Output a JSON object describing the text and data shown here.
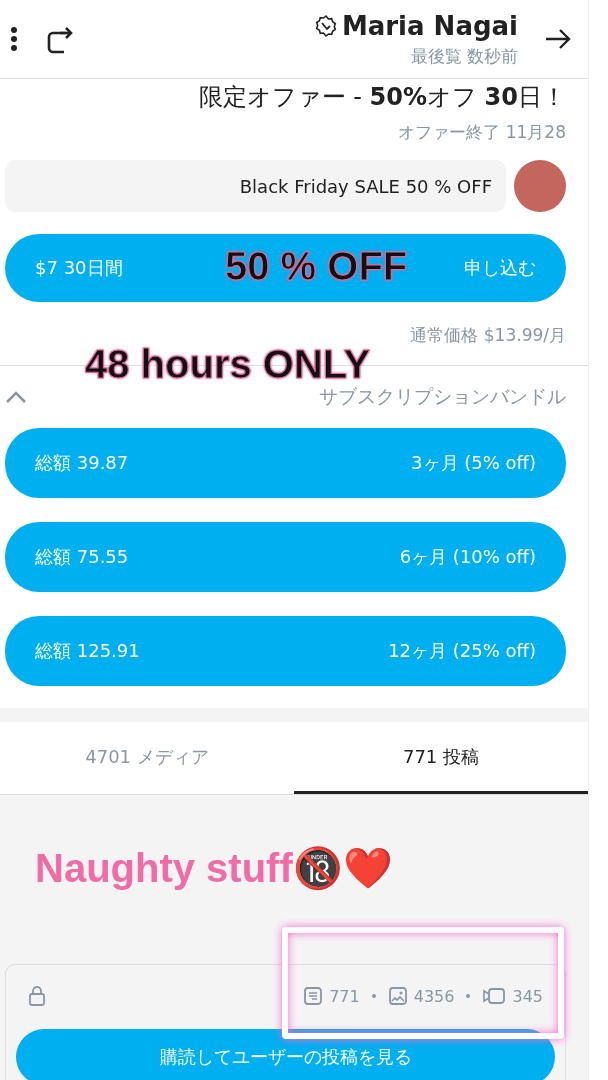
{
  "header": {
    "name": "Maria Nagai",
    "verified": true,
    "last_seen": "最後覧 数秒前"
  },
  "promo": {
    "title": "限定オファー - **50%**オフ **30**日！",
    "ends": "オファー終了 11月28",
    "message": "Black Friday SALE 50 % OFF"
  },
  "subscribe": {
    "price": "$7 30日間",
    "sticker": "50 % OFF",
    "label": "申し込む"
  },
  "regular_price": "通常価格 $13.99/月",
  "hours_sticker": "48 hours ONLY",
  "bundles": {
    "expanded": true,
    "title": "サブスクリプションバンドル",
    "items": [
      {
        "total": "総額 39.87",
        "label": "3ヶ月 (5% off)"
      },
      {
        "total": "総額 75.55",
        "label": "6ヶ月 (10% off)"
      },
      {
        "total": "総額 125.91",
        "label": "12ヶ月 (25% off)"
      }
    ]
  },
  "tabs": [
    {
      "label": "4701 メディア",
      "selected": false
    },
    {
      "label": "771 投稿",
      "selected": true
    }
  ],
  "caption": "Naughty stuff🔞❤️",
  "locked": {
    "counts": [
      {
        "kind": "posts",
        "value": "771"
      },
      {
        "kind": "photos",
        "value": "4356"
      },
      {
        "kind": "videos",
        "value": "345"
      }
    ],
    "button": "購読してユーザーの投稿を見る"
  }
}
